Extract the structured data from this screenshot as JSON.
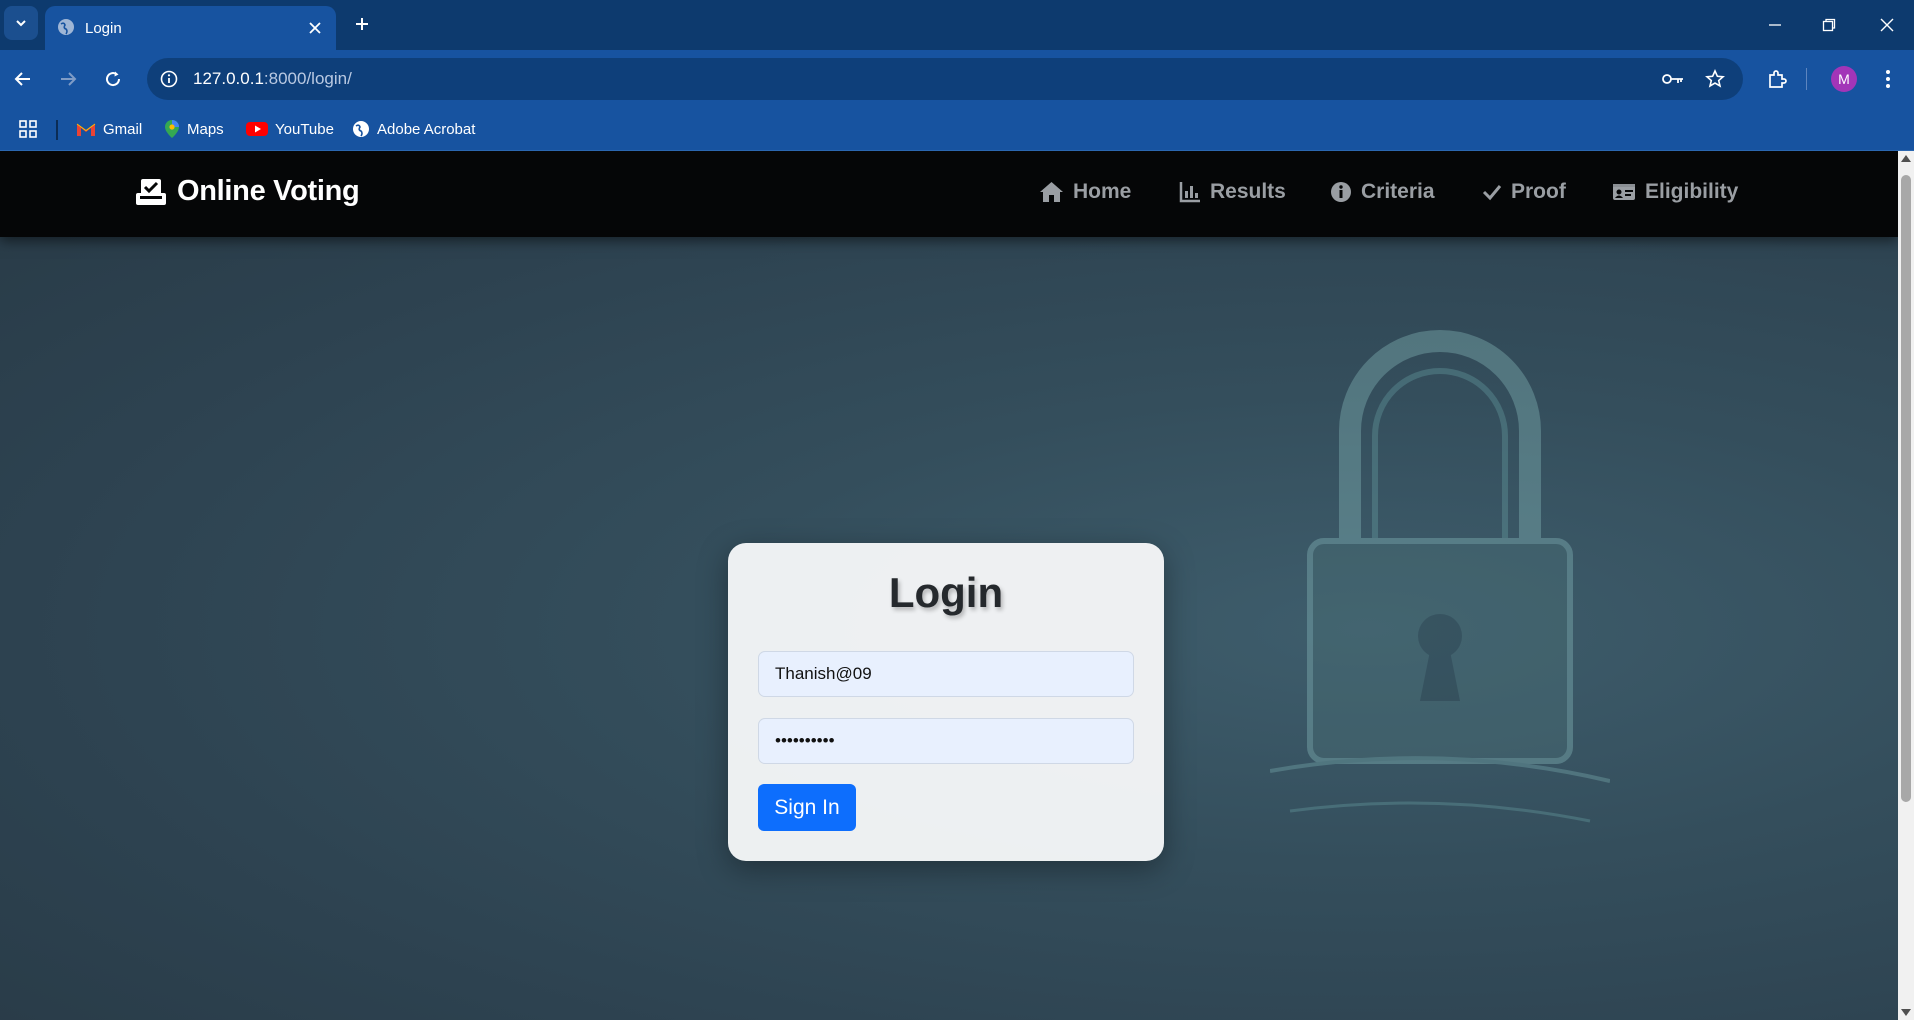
{
  "browser": {
    "tab_title": "Login",
    "url_host": "127.0.0.1",
    "url_rest": ":8000/login/",
    "profile_initial": "M",
    "bookmarks": [
      {
        "label": "Gmail",
        "icon": "gmail-icon"
      },
      {
        "label": "Maps",
        "icon": "maps-icon"
      },
      {
        "label": "YouTube",
        "icon": "youtube-icon"
      },
      {
        "label": "Adobe Acrobat",
        "icon": "globe-icon"
      }
    ]
  },
  "navbar": {
    "brand": "Online Voting",
    "items": [
      {
        "label": "Home",
        "icon": "home-icon"
      },
      {
        "label": "Results",
        "icon": "chart-icon"
      },
      {
        "label": "Criteria",
        "icon": "info-icon"
      },
      {
        "label": "Proof",
        "icon": "check-icon"
      },
      {
        "label": "Eligibility",
        "icon": "id-card-icon"
      }
    ]
  },
  "login": {
    "title": "Login",
    "username_value": "Thanish@09",
    "password_value": "••••••••••",
    "submit_label": "Sign In"
  },
  "colors": {
    "chrome_dark": "#0d3a6e",
    "chrome": "#1753a0",
    "navbar_bg": "#050607",
    "primary_button": "#0d6efd"
  }
}
